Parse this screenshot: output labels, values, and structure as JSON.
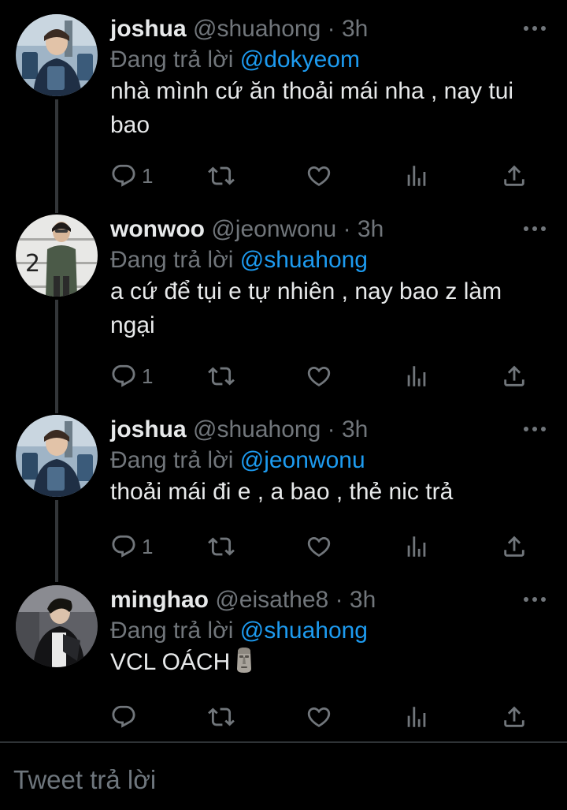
{
  "tweets": [
    {
      "display_name": "joshua",
      "handle": "@shuahong",
      "separator": "·",
      "time": "3h",
      "reply_prefix": "Đang trả lời",
      "reply_to": "@dokyeom",
      "text": "nhà mình cứ ăn thoải mái nha , nay tui bao",
      "reply_count": "1",
      "avatar": "joshua-avatar"
    },
    {
      "display_name": "wonwoo",
      "handle": "@jeonwonu",
      "separator": "·",
      "time": "3h",
      "reply_prefix": "Đang trả lời",
      "reply_to": "@shuahong",
      "text": "a cứ để tụi e tự nhiên , nay bao z làm ngại",
      "reply_count": "1",
      "avatar": "wonwoo-avatar",
      "avatar_badge": "2"
    },
    {
      "display_name": "joshua",
      "handle": "@shuahong",
      "separator": "·",
      "time": "3h",
      "reply_prefix": "Đang trả lời",
      "reply_to": "@jeonwonu",
      "text": "thoải mái đi e , a bao , thẻ nic trả",
      "reply_count": "1",
      "avatar": "joshua-avatar"
    },
    {
      "display_name": "minghao",
      "handle": "@eisathe8",
      "separator": "·",
      "time": "3h",
      "reply_prefix": "Đang trả lời",
      "reply_to": "@shuahong",
      "text": "VCL OÁCH",
      "emoji": "moai-emoji",
      "reply_count": "",
      "avatar": "minghao-avatar"
    }
  ],
  "composer": {
    "placeholder": "Tweet trả lời"
  },
  "icons": {
    "reply": "reply-icon",
    "retweet": "retweet-icon",
    "like": "heart-icon",
    "views": "analytics-icon",
    "share": "share-icon",
    "more": "more-dots-icon"
  },
  "colors": {
    "background": "#000000",
    "text_primary": "#e7e9ea",
    "text_secondary": "#71767b",
    "accent": "#1d9bf0",
    "divider": "#2f3336"
  }
}
